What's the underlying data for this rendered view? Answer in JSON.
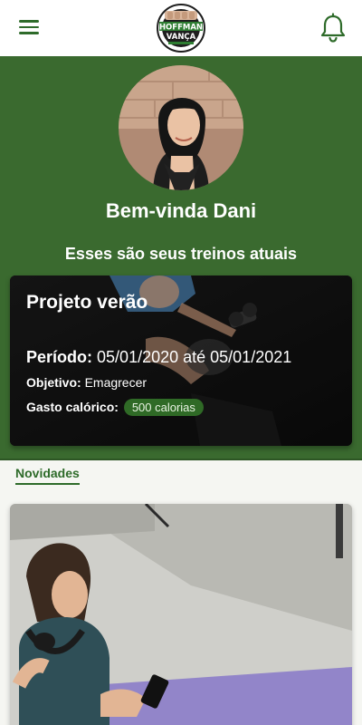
{
  "app": {
    "logo_text_1": "HOFFMAN",
    "logo_text_2": "VANÇA"
  },
  "header": {
    "menu_icon": "menu-icon",
    "notifications_icon": "bell-icon"
  },
  "profile": {
    "greeting": "Bem-vinda Dani",
    "subtitle": "Esses são seus treinos atuais"
  },
  "workout": {
    "title": "Projeto verão",
    "period_label": "Período:",
    "period_value": "05/01/2020 até 05/01/2021",
    "goal_label": "Objetivo:",
    "goal_value": "Emagrecer",
    "calories_label": "Gasto calórico:",
    "calories_value": "500 calorias"
  },
  "news": {
    "tab_label": "Novidades"
  },
  "colors": {
    "brand_green": "#3a6a2f",
    "accent_green": "#2e6b2a",
    "badge_green": "#2f6a26"
  }
}
